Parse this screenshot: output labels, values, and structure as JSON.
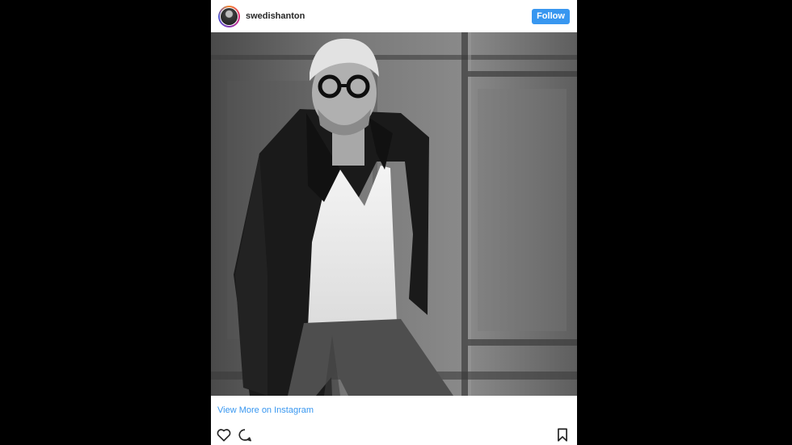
{
  "post": {
    "username": "swedishanton",
    "follow_label": "Follow",
    "view_more_label": "View More on Instagram"
  },
  "icons": {
    "like": "heart-icon",
    "comment": "comment-icon",
    "save": "bookmark-icon"
  },
  "colors": {
    "background": "#000000",
    "card": "#ffffff",
    "accent": "#3897f0",
    "text": "#262626"
  }
}
